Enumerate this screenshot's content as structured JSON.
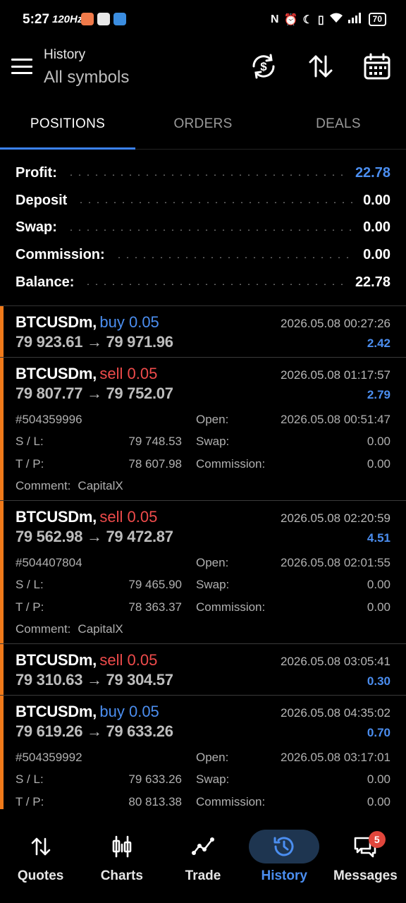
{
  "status_bar": {
    "time": "5:27",
    "refresh_rate": "120Hz",
    "battery": "70",
    "icons": [
      "app-icon-orange",
      "app-icon-white",
      "app-icon-blue",
      "nfc-icon",
      "alarm-icon",
      "moon-icon",
      "vibrate-icon",
      "wifi-icon",
      "signal-icon",
      "battery-icon"
    ]
  },
  "header": {
    "title": "History",
    "subtitle": "All symbols",
    "icons": [
      "menu-icon",
      "currency-sync-icon",
      "sort-icon",
      "calendar-icon"
    ]
  },
  "tabs": [
    {
      "label": "POSITIONS",
      "active": true
    },
    {
      "label": "ORDERS",
      "active": false
    },
    {
      "label": "DEALS",
      "active": false
    }
  ],
  "summary": [
    {
      "label": "Profit:",
      "value": "22.78",
      "highlight": true
    },
    {
      "label": "Deposit",
      "value": "0.00",
      "highlight": false
    },
    {
      "label": "Swap:",
      "value": "0.00",
      "highlight": false
    },
    {
      "label": "Commission:",
      "value": "0.00",
      "highlight": false
    },
    {
      "label": "Balance:",
      "value": "22.78",
      "highlight": false
    }
  ],
  "positions": [
    {
      "symbol": "BTCUSDm,",
      "side": "buy 0.05",
      "side_type": "buy",
      "time": "2026.05.08 00:27:26",
      "prices": "79 923.61 → 79 971.96",
      "profit": "2.42"
    },
    {
      "symbol": "BTCUSDm,",
      "side": "sell 0.05",
      "side_type": "sell",
      "time": "2026.05.08 01:17:57",
      "prices": "79 807.77 → 79 752.07",
      "profit": "2.79",
      "details": {
        "ticket": "#504359996",
        "open_label": "Open:",
        "open": "2026.05.08 00:51:47",
        "sl_label": "S / L:",
        "sl": "79 748.53",
        "swap_label": "Swap:",
        "swap": "0.00",
        "tp_label": "T / P:",
        "tp": "78 607.98",
        "commission_label": "Commission:",
        "commission": "0.00",
        "comment_label": "Comment:",
        "comment": "CapitalX"
      }
    },
    {
      "symbol": "BTCUSDm,",
      "side": "sell 0.05",
      "side_type": "sell",
      "time": "2026.05.08 02:20:59",
      "prices": "79 562.98 → 79 472.87",
      "profit": "4.51",
      "details": {
        "ticket": "#504407804",
        "open_label": "Open:",
        "open": "2026.05.08 02:01:55",
        "sl_label": "S / L:",
        "sl": "79 465.90",
        "swap_label": "Swap:",
        "swap": "0.00",
        "tp_label": "T / P:",
        "tp": "78 363.37",
        "commission_label": "Commission:",
        "commission": "0.00",
        "comment_label": "Comment:",
        "comment": "CapitalX"
      }
    },
    {
      "symbol": "BTCUSDm,",
      "side": "sell 0.05",
      "side_type": "sell",
      "time": "2026.05.08 03:05:41",
      "prices": "79 310.63 → 79 304.57",
      "profit": "0.30"
    },
    {
      "symbol": "BTCUSDm,",
      "side": "buy 0.05",
      "side_type": "buy",
      "time": "2026.05.08 04:35:02",
      "prices": "79 619.26 → 79 633.26",
      "profit": "0.70",
      "details": {
        "ticket": "#504359992",
        "open_label": "Open:",
        "open": "2026.05.08 03:17:01",
        "sl_label": "S / L:",
        "sl": "79 633.26",
        "swap_label": "Swap:",
        "swap": "0.00",
        "tp_label": "T / P:",
        "tp": "80 813.38",
        "commission_label": "Commission:",
        "commission": "0.00"
      }
    }
  ],
  "bottom_nav": [
    {
      "label": "Quotes",
      "icon": "quotes-icon",
      "active": false
    },
    {
      "label": "Charts",
      "icon": "charts-icon",
      "active": false
    },
    {
      "label": "Trade",
      "icon": "trade-icon",
      "active": false
    },
    {
      "label": "History",
      "icon": "history-icon",
      "active": true
    },
    {
      "label": "Messages",
      "icon": "messages-icon",
      "active": false,
      "badge": "5"
    }
  ],
  "colors": {
    "accent": "#4b8ef0",
    "sell": "#ef4b4b",
    "marker": "#f07a1a",
    "background": "#000000"
  }
}
